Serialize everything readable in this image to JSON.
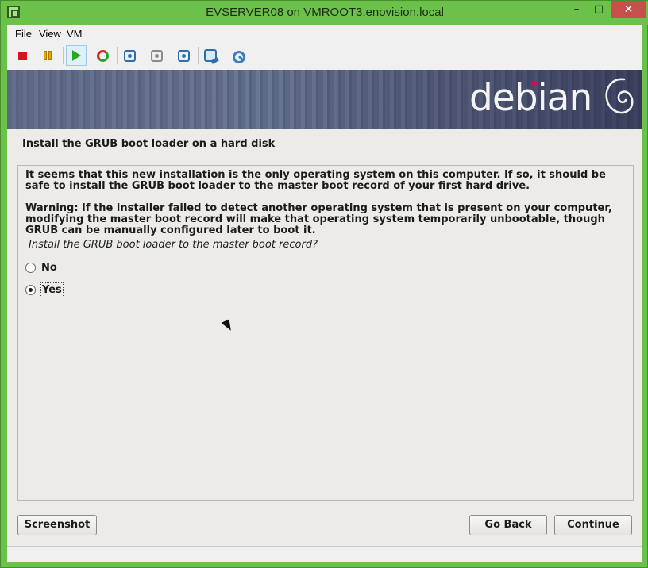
{
  "window": {
    "title": "EVSERVER08 on VMROOT3.enovision.local",
    "controls": {
      "minimize": "–",
      "maximize": "□",
      "close": "✕"
    }
  },
  "menu": {
    "file": "File",
    "view": "View",
    "vm": "VM"
  },
  "toolbar": {
    "buttons": [
      {
        "name": "turn-off",
        "icon": "stop-icon"
      },
      {
        "name": "pause",
        "icon": "pause-icon"
      },
      {
        "name": "start",
        "icon": "play-icon",
        "active": true
      },
      {
        "name": "reset",
        "icon": "reset-icon"
      },
      {
        "name": "checkpoint",
        "icon": "snapshot-icon"
      },
      {
        "name": "revert",
        "icon": "revert-icon"
      },
      {
        "name": "enhanced-session",
        "icon": "session-icon"
      },
      {
        "name": "settings",
        "icon": "settings-icon"
      },
      {
        "name": "insert-disk",
        "icon": "tools-icon"
      }
    ]
  },
  "installer": {
    "logo_text": "debian",
    "heading": "Install the GRUB boot loader on a hard disk",
    "paragraph1": "It seems that this new installation is the only operating system on this computer. If so, it should be safe to install the GRUB boot loader to the master boot record of your first hard drive.",
    "paragraph2": "Warning: If the installer failed to detect another operating system that is present on your computer, modifying the master boot record will make that operating system temporarily unbootable, though GRUB can be manually configured later to boot it.",
    "question": "Install the GRUB boot loader to the master boot record?",
    "options": [
      {
        "label": "No",
        "selected": false
      },
      {
        "label": "Yes",
        "selected": true
      }
    ],
    "buttons": {
      "screenshot": "Screenshot",
      "go_back": "Go Back",
      "continue": "Continue"
    }
  },
  "colors": {
    "frame": "#6cc14a",
    "close": "#c7504a",
    "debian_red": "#d70a53",
    "banner": "#5e6a86"
  }
}
